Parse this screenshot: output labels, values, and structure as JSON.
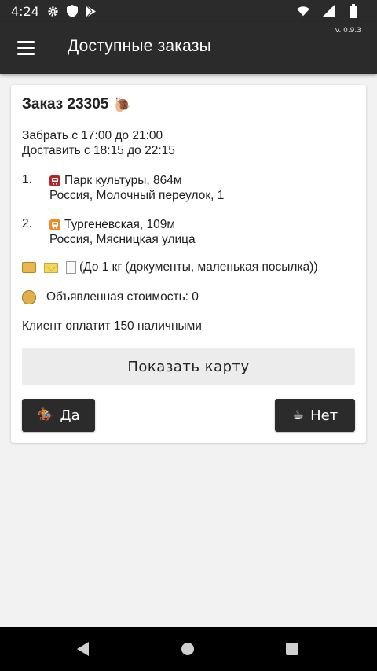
{
  "status_bar": {
    "time": "4:24",
    "icons": [
      "gear-icon",
      "shield-icon",
      "play-store-icon"
    ],
    "right_icons": [
      "wifi-icon",
      "signal-icon",
      "battery-icon"
    ]
  },
  "app_bar": {
    "title": "Доступные заказы",
    "version": "v. 0.9.3"
  },
  "order": {
    "title": "Заказ 23305",
    "title_icon": "🐌",
    "pickup": "Забрать с 17:00 до 21:00",
    "deliver": "Доставить с 18:15 до 22:15",
    "stops": [
      {
        "num": "1.",
        "metro_color": "#b3262c",
        "name": "Парк культуры, 864м",
        "address": "Россия, Молочный переулок, 1"
      },
      {
        "num": "2.",
        "metro_color": "#f08a24",
        "name": "Тургеневская, 109м",
        "address": "Россия, Мясницкая улица"
      }
    ],
    "parcel_text": "(До 1 кг (документы, маленькая посылка))",
    "declared_value": "Объявленная стоимость: 0",
    "payment": "Клиент оплатит 150 наличными"
  },
  "buttons": {
    "map": "Показать карту",
    "yes": "Да",
    "yes_icon": "🏇",
    "no": "Нет",
    "no_icon": "☕"
  },
  "nav_bar": {
    "icons": [
      "back-icon",
      "home-icon",
      "recents-icon"
    ]
  }
}
